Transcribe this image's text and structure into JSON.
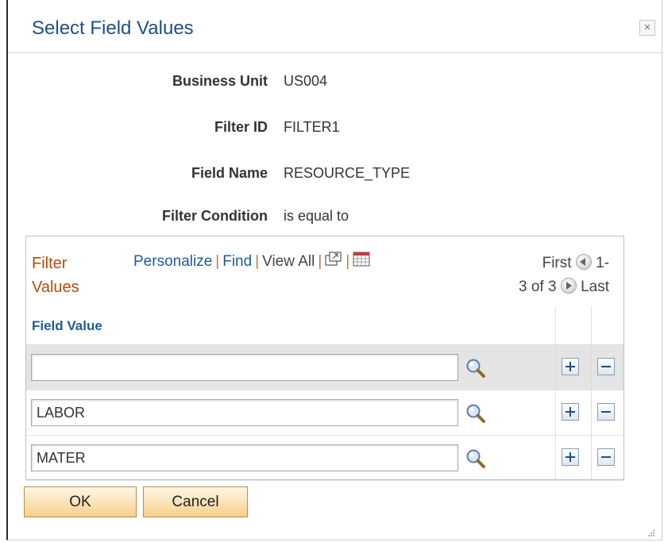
{
  "dialog": {
    "title": "Select Field Values",
    "close_label": "×"
  },
  "info": [
    {
      "label": "Business Unit",
      "value": "US004"
    },
    {
      "label": "Filter ID",
      "value": "FILTER1"
    },
    {
      "label": "Field Name",
      "value": "RESOURCE_TYPE"
    },
    {
      "label": "Filter Condition",
      "value": "is equal to"
    }
  ],
  "grid": {
    "title_line1": "Filter",
    "title_line2": "Values",
    "links": {
      "personalize": "Personalize",
      "separator": "|",
      "find": "Find",
      "view_all": "View All"
    },
    "pager": {
      "first": "First",
      "range_part1": "1-",
      "range_part2": "3 of 3",
      "last": "Last"
    },
    "column_header": "Field Value",
    "rows": [
      {
        "value": ""
      },
      {
        "value": "LABOR"
      },
      {
        "value": "MATER"
      }
    ]
  },
  "buttons": {
    "ok": "OK",
    "cancel": "Cancel"
  },
  "colors": {
    "title": "#1f4f86",
    "grid_title": "#b04d0c",
    "link": "#1f5a9b",
    "button_fill": "#f7d08c"
  }
}
